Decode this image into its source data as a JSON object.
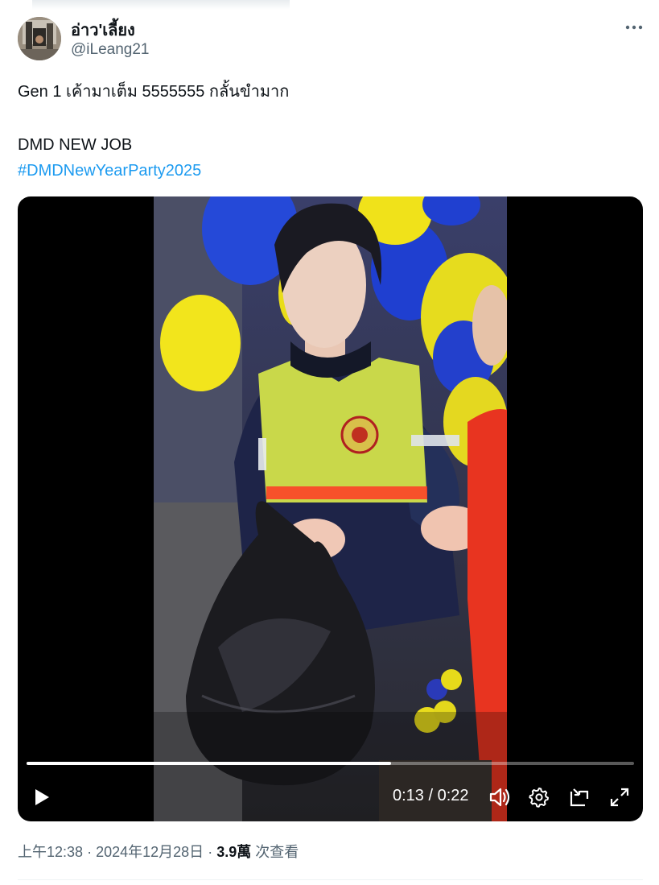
{
  "tweet": {
    "display_name": "อ่าว'เลี้ยง",
    "handle": "@iLeang21",
    "text_line1": "Gen 1 เค้ามาเต็ม 5555555 กลั้นขำมาก",
    "text_line2": "DMD NEW JOB",
    "hashtag": "#DMDNewYearParty2025",
    "time": "上午12:38",
    "separator": "·",
    "date": "2024年12月28日",
    "views_count": "3.9萬",
    "views_label": "次查看"
  },
  "video": {
    "current_time": "0:13",
    "duration": "0:22",
    "time_separator": " / ",
    "progress": 0.6,
    "icons": {
      "play": "play-icon",
      "volume": "volume-icon",
      "settings": "gear-icon",
      "pip": "picture-in-picture-icon",
      "fullscreen": "fullscreen-icon"
    }
  },
  "colors": {
    "accent": "#1d9bf0",
    "text": "#0f1419",
    "muted": "#536471"
  }
}
